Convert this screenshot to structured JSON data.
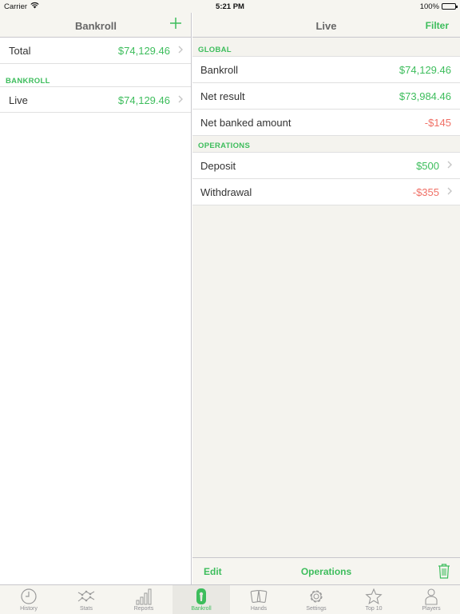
{
  "status_bar": {
    "carrier": "Carrier",
    "time": "5:21 PM",
    "battery": "100%"
  },
  "left": {
    "title": "Bankroll",
    "add_icon": "plus-icon",
    "total": {
      "label": "Total",
      "value": "$74,129.46"
    },
    "section": "BANKROLL",
    "items": [
      {
        "label": "Live",
        "value": "$74,129.46"
      }
    ]
  },
  "right": {
    "title": "Live",
    "filter": "Filter",
    "global_section": "GLOBAL",
    "global": [
      {
        "label": "Bankroll",
        "value": "$74,129.46"
      },
      {
        "label": "Net result",
        "value": "$73,984.46"
      },
      {
        "label": "Net banked amount",
        "value": "-$145"
      }
    ],
    "operations_section": "OPERATIONS",
    "operations": [
      {
        "label": "Deposit",
        "value": "$500"
      },
      {
        "label": "Withdrawal",
        "value": "-$355"
      }
    ],
    "toolbar": {
      "edit": "Edit",
      "operations": "Operations",
      "trash_icon": "trash-icon"
    }
  },
  "colors": {
    "accent": "#3dbd5c",
    "negative": "#f07066"
  },
  "tabs": [
    {
      "label": "History",
      "icon": "clock-icon"
    },
    {
      "label": "Stats",
      "icon": "stats-graph-icon"
    },
    {
      "label": "Reports",
      "icon": "bar-chart-icon"
    },
    {
      "label": "Bankroll",
      "icon": "bankroll-icon",
      "active": true
    },
    {
      "label": "Hands",
      "icon": "cards-icon"
    },
    {
      "label": "Settings",
      "icon": "gear-icon"
    },
    {
      "label": "Top 10",
      "icon": "star-icon"
    },
    {
      "label": "Players",
      "icon": "person-icon"
    }
  ]
}
